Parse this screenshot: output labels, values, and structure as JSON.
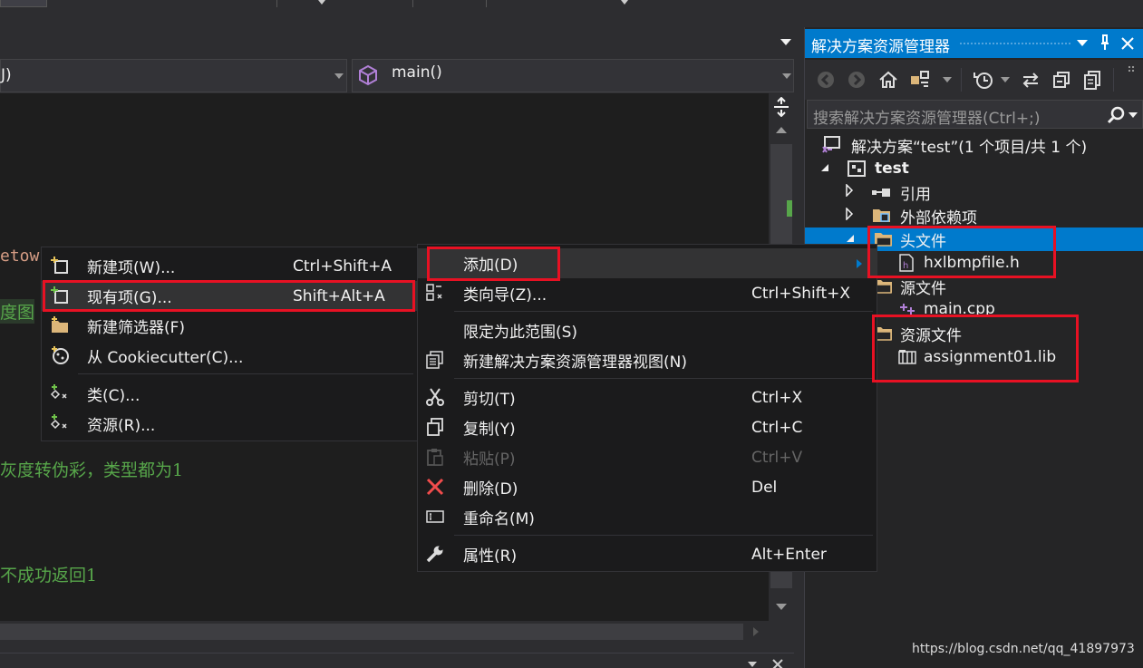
{
  "editor": {
    "dropdown_left_text": "J)",
    "dropdown_right_text": "main()",
    "code_lines": [
      {
        "text": "etow"
      },
      {
        "text": "度图"
      },
      {
        "text": "灰度转伪彩，类型都为1"
      },
      {
        "text": "不成功返回1"
      }
    ]
  },
  "submenu": {
    "items": [
      {
        "label": "新建项(W)...",
        "shortcut": "Ctrl+Shift+A",
        "icon": "new-item-icon"
      },
      {
        "label": "现有项(G)...",
        "shortcut": "Shift+Alt+A",
        "icon": "existing-item-icon"
      },
      {
        "label": "新建筛选器(F)",
        "shortcut": "",
        "icon": "new-filter-icon"
      },
      {
        "label": "从 Cookiecutter(C)...",
        "shortcut": "",
        "icon": "cookiecutter-icon"
      },
      {
        "label": "类(C)...",
        "shortcut": "",
        "icon": "class-icon"
      },
      {
        "label": "资源(R)...",
        "shortcut": "",
        "icon": "resource-icon"
      }
    ]
  },
  "context_menu": {
    "items": [
      {
        "label": "添加(D)",
        "shortcut": "",
        "icon": ""
      },
      {
        "label": "类向导(Z)...",
        "shortcut": "Ctrl+Shift+X",
        "icon": "class-wizard-icon"
      },
      {
        "label": "限定为此范围(S)",
        "shortcut": "",
        "icon": ""
      },
      {
        "label": "新建解决方案资源管理器视图(N)",
        "shortcut": "",
        "icon": "new-view-icon"
      },
      {
        "label": "剪切(T)",
        "shortcut": "Ctrl+X",
        "icon": "scissors-icon"
      },
      {
        "label": "复制(Y)",
        "shortcut": "Ctrl+C",
        "icon": "copy-icon"
      },
      {
        "label": "粘贴(P)",
        "shortcut": "Ctrl+V",
        "icon": "paste-icon"
      },
      {
        "label": "删除(D)",
        "shortcut": "Del",
        "icon": "delete-icon"
      },
      {
        "label": "重命名(M)",
        "shortcut": "",
        "icon": "rename-icon"
      },
      {
        "label": "属性(R)",
        "shortcut": "Alt+Enter",
        "icon": "wrench-icon"
      }
    ]
  },
  "solution_explorer": {
    "title": "解决方案资源管理器",
    "search_placeholder": "搜索解决方案资源管理器(Ctrl+;)",
    "tree": [
      {
        "label": "解决方案“test”(1 个项目/共 1 个)"
      },
      {
        "label": "test"
      },
      {
        "label": "引用"
      },
      {
        "label": "外部依赖项"
      },
      {
        "label": "头文件"
      },
      {
        "label": "hxlbmpfile.h"
      },
      {
        "label": "源文件"
      },
      {
        "label": "main.cpp"
      },
      {
        "label": "资源文件"
      },
      {
        "label": "assignment01.lib"
      }
    ]
  },
  "watermark": "https://blog.csdn.net/qq_41897973",
  "colors": {
    "accent": "#007acc",
    "highlight_box": "#e81123",
    "comment_green": "#57a64a",
    "background": "#2d2d30",
    "editor_bg": "#1e1e1e",
    "menu_bg": "#1b1b1c"
  }
}
